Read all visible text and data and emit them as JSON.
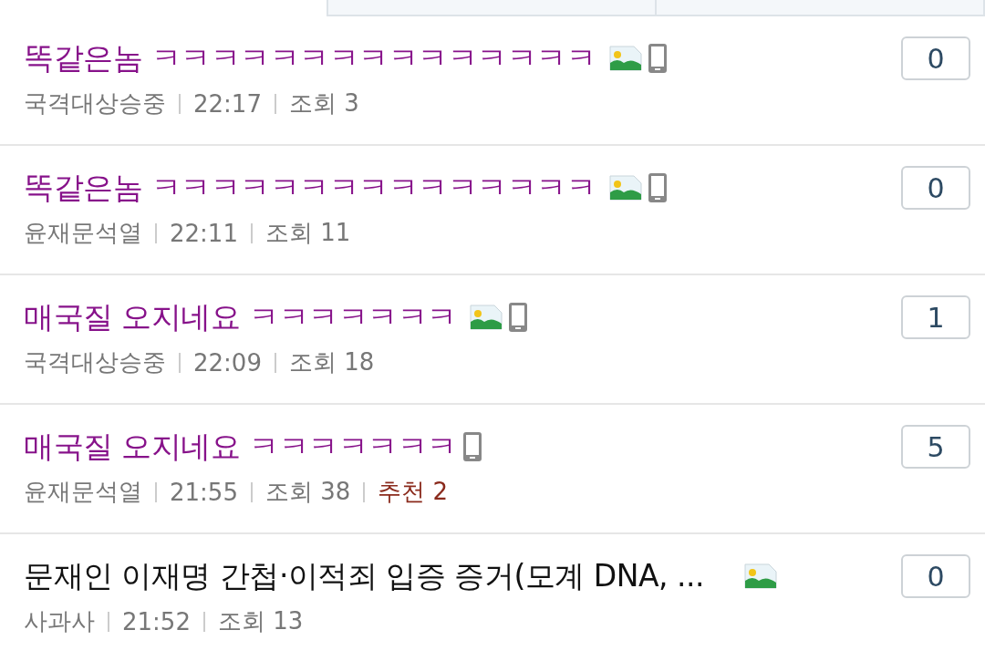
{
  "posts": [
    {
      "title": "똑같은놈 ㅋㅋㅋㅋㅋㅋㅋㅋㅋㅋㅋㅋㅋㅋㅋ",
      "visited": true,
      "has_image": true,
      "mobile": true,
      "author": "국격대상승중",
      "time": "22:17",
      "views": "조회 3",
      "comments": "0"
    },
    {
      "title": "똑같은놈 ㅋㅋㅋㅋㅋㅋㅋㅋㅋㅋㅋㅋㅋㅋㅋ",
      "visited": true,
      "has_image": true,
      "mobile": true,
      "author": "윤재문석열",
      "time": "22:11",
      "views": "조회 11",
      "comments": "0"
    },
    {
      "title": "매국질 오지네요 ㅋㅋㅋㅋㅋㅋㅋ",
      "visited": true,
      "has_image": true,
      "mobile": true,
      "author": "국격대상승중",
      "time": "22:09",
      "views": "조회 18",
      "comments": "1"
    },
    {
      "title": "매국질 오지네요 ㅋㅋㅋㅋㅋㅋㅋ",
      "visited": true,
      "has_image": false,
      "mobile": true,
      "author": "윤재문석열",
      "time": "21:55",
      "views": "조회 38",
      "recommend": "추천 2",
      "comments": "5"
    },
    {
      "title": "문재인 이재명 간첩·이적죄 입증 증거(모계 DNA, ...",
      "visited": false,
      "has_image": true,
      "mobile": false,
      "author": "사과사",
      "time": "21:52",
      "views": "조회 13",
      "comments": "0"
    }
  ]
}
